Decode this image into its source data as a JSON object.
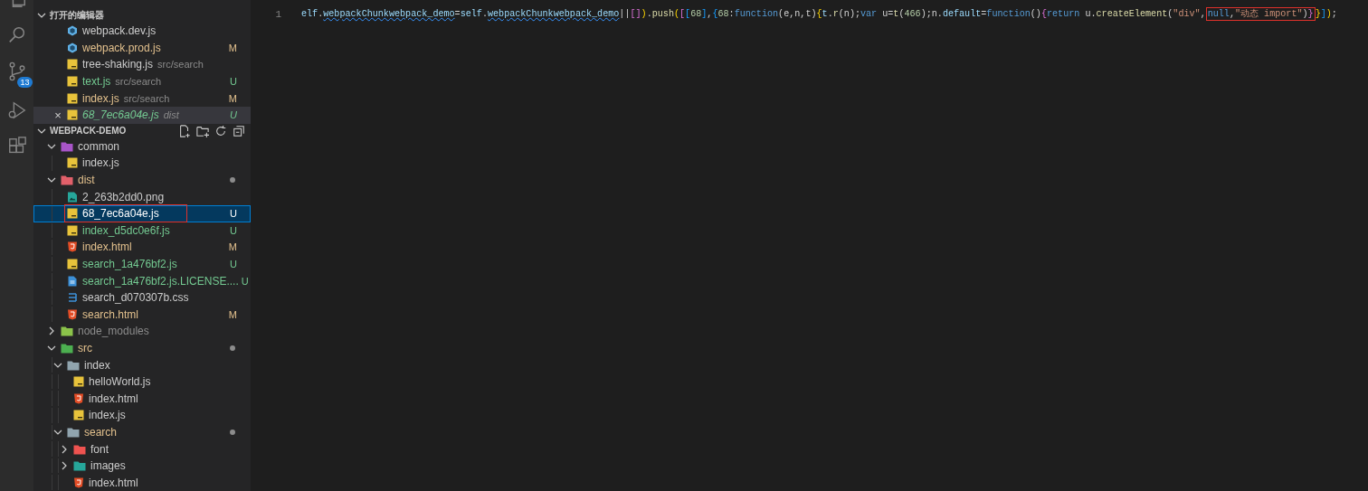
{
  "activity_bar": {
    "items": [
      {
        "kind": "explorer"
      },
      {
        "kind": "search"
      },
      {
        "kind": "source-control",
        "badge": "13"
      },
      {
        "kind": "debug"
      },
      {
        "kind": "extensions"
      }
    ]
  },
  "sidebar": {
    "open_editors": {
      "title": "打开的编辑器",
      "expanded": true,
      "items": [
        {
          "name": "webpack.dev.js",
          "kind": "webpack",
          "modified": false,
          "untracked": false,
          "selected": false,
          "preview": false
        },
        {
          "name": "webpack.prod.js",
          "kind": "webpack",
          "modified": true,
          "untracked": false,
          "status": "M",
          "selected": false,
          "preview": false
        },
        {
          "name": "tree-shaking.js",
          "description": "src/search",
          "kind": "js",
          "modified": false,
          "untracked": false,
          "selected": false,
          "preview": false
        },
        {
          "name": "text.js",
          "description": "src/search",
          "kind": "js",
          "modified": false,
          "untracked": true,
          "status": "U",
          "selected": false,
          "preview": false
        },
        {
          "name": "index.js",
          "description": "src/search",
          "kind": "js",
          "modified": true,
          "untracked": false,
          "status": "M",
          "selected": false,
          "preview": false
        },
        {
          "name": "68_7ec6a04e.js",
          "description": "dist",
          "kind": "js",
          "modified": false,
          "untracked": true,
          "status": "U",
          "selected": true,
          "preview": true,
          "close": "×"
        }
      ]
    },
    "project": {
      "title": "WEBPACK-DEMO",
      "expanded": true,
      "items": [
        {
          "name": "common",
          "kind": "folder",
          "color": "#a855c8",
          "expanded": true,
          "ignored": false,
          "modified": false,
          "selected": false,
          "children": [
            {
              "name": "index.js",
              "kind": "js",
              "modified": false,
              "untracked": false,
              "selected": false
            }
          ]
        },
        {
          "name": "dist",
          "kind": "folder",
          "color": "#e2606a",
          "expanded": true,
          "ignored": false,
          "modified": true,
          "dot": true,
          "selected": false,
          "children": [
            {
              "name": "2_263b2dd0.png",
              "kind": "image",
              "modified": false,
              "untracked": false,
              "selected": false
            },
            {
              "name": "68_7ec6a04e.js",
              "kind": "js",
              "modified": false,
              "untracked": true,
              "status": "U",
              "selected": true,
              "boxed": true
            },
            {
              "name": "index_d5dc0e6f.js",
              "kind": "js",
              "modified": false,
              "untracked": true,
              "status": "U",
              "selected": false
            },
            {
              "name": "index.html",
              "kind": "html",
              "modified": true,
              "untracked": false,
              "status": "M",
              "selected": false
            },
            {
              "name": "search_1a476bf2.js",
              "kind": "js",
              "modified": false,
              "untracked": true,
              "status": "U",
              "selected": false
            },
            {
              "name": "search_1a476bf2.js.LICENSE....",
              "kind": "text",
              "modified": false,
              "untracked": true,
              "status": "U",
              "selected": false
            },
            {
              "name": "search_d070307b.css",
              "kind": "css",
              "modified": false,
              "untracked": false,
              "selected": false
            },
            {
              "name": "search.html",
              "kind": "html",
              "modified": true,
              "untracked": false,
              "status": "M",
              "selected": false
            }
          ]
        },
        {
          "name": "node_modules",
          "kind": "folder",
          "color": "#8bc34a",
          "expanded": false,
          "ignored": true,
          "modified": false,
          "selected": false
        },
        {
          "name": "src",
          "kind": "folder",
          "color": "#4caf50",
          "expanded": true,
          "ignored": false,
          "modified": true,
          "dot": true,
          "selected": false,
          "children": [
            {
              "name": "index",
              "kind": "folder",
              "color": "#90a4ae",
              "expanded": true,
              "modified": false,
              "selected": false,
              "children": [
                {
                  "name": "helloWorld.js",
                  "kind": "js",
                  "modified": false,
                  "untracked": false,
                  "selected": false
                },
                {
                  "name": "index.html",
                  "kind": "html",
                  "modified": false,
                  "untracked": false,
                  "selected": false
                },
                {
                  "name": "index.js",
                  "kind": "js",
                  "modified": false,
                  "untracked": false,
                  "selected": false
                }
              ]
            },
            {
              "name": "search",
              "kind": "folder",
              "color": "#90a4ae",
              "expanded": true,
              "modified": true,
              "dot": true,
              "selected": false,
              "children": [
                {
                  "name": "font",
                  "kind": "folder",
                  "color": "#ef5350",
                  "expanded": false,
                  "modified": false,
                  "selected": false
                },
                {
                  "name": "images",
                  "kind": "folder",
                  "color": "#26a69a",
                  "expanded": false,
                  "modified": false,
                  "selected": false
                },
                {
                  "name": "index.html",
                  "kind": "html",
                  "modified": false,
                  "untracked": false,
                  "selected": false
                }
              ]
            }
          ]
        }
      ]
    }
  },
  "editor": {
    "lines": [
      {
        "number": "1",
        "tokens": [
          {
            "text": "elf",
            "kind": "var"
          },
          {
            "text": ".",
            "kind": "plain"
          },
          {
            "text": "webpackChunkwebpack_demo",
            "kind": "warn"
          },
          {
            "text": "=",
            "kind": "plain"
          },
          {
            "text": "self",
            "kind": "var"
          },
          {
            "text": ".",
            "kind": "plain"
          },
          {
            "text": "webpackChunkwebpack_demo",
            "kind": "warn"
          },
          {
            "text": "||",
            "kind": "plain"
          },
          {
            "text": "[]",
            "kind": "bracket2"
          },
          {
            "text": ")",
            "kind": "bracket1"
          },
          {
            "text": ".",
            "kind": "plain"
          },
          {
            "text": "push",
            "kind": "func"
          },
          {
            "text": "(",
            "kind": "bracket1"
          },
          {
            "text": "[",
            "kind": "bracket2"
          },
          {
            "text": "[",
            "kind": "bracket3"
          },
          {
            "text": "68",
            "kind": "number"
          },
          {
            "text": "]",
            "kind": "bracket3"
          },
          {
            "text": ",",
            "kind": "plain"
          },
          {
            "text": "{",
            "kind": "bracket3"
          },
          {
            "text": "68",
            "kind": "number"
          },
          {
            "text": ":",
            "kind": "plain"
          },
          {
            "text": "function",
            "kind": "keyword"
          },
          {
            "text": "(e,n,t)",
            "kind": "plain"
          },
          {
            "text": "{",
            "kind": "bracket1"
          },
          {
            "text": "t",
            "kind": "var"
          },
          {
            "text": ".",
            "kind": "plain"
          },
          {
            "text": "r",
            "kind": "func"
          },
          {
            "text": "(n);",
            "kind": "plain"
          },
          {
            "text": "var",
            "kind": "keyword"
          },
          {
            "text": " u=",
            "kind": "plain"
          },
          {
            "text": "t",
            "kind": "func"
          },
          {
            "text": "(",
            "kind": "plain"
          },
          {
            "text": "466",
            "kind": "number"
          },
          {
            "text": ");n.",
            "kind": "plain"
          },
          {
            "text": "default",
            "kind": "var"
          },
          {
            "text": "=",
            "kind": "plain"
          },
          {
            "text": "function",
            "kind": "keyword"
          },
          {
            "text": "()",
            "kind": "plain"
          },
          {
            "text": "{",
            "kind": "bracket2"
          },
          {
            "text": "return",
            "kind": "keyword"
          },
          {
            "text": " u.",
            "kind": "plain"
          },
          {
            "text": "createElement",
            "kind": "func"
          },
          {
            "text": "(",
            "kind": "plain"
          },
          {
            "text": "\"div\"",
            "kind": "string"
          },
          {
            "text": ",",
            "kind": "plain"
          }
        ],
        "boxed_tokens": [
          {
            "text": "null",
            "kind": "keyword"
          },
          {
            "text": ",",
            "kind": "plain"
          },
          {
            "text": "\"动态 import\"",
            "kind": "string"
          },
          {
            "text": ")",
            "kind": "plain"
          },
          {
            "text": "}",
            "kind": "bracket2"
          }
        ],
        "after_tokens": [
          {
            "text": "}",
            "kind": "bracket1"
          },
          {
            "text": "]",
            "kind": "bracket3"
          },
          {
            "text": ")",
            "kind": "bracket1"
          },
          {
            "text": ";",
            "kind": "plain"
          }
        ]
      }
    ]
  }
}
